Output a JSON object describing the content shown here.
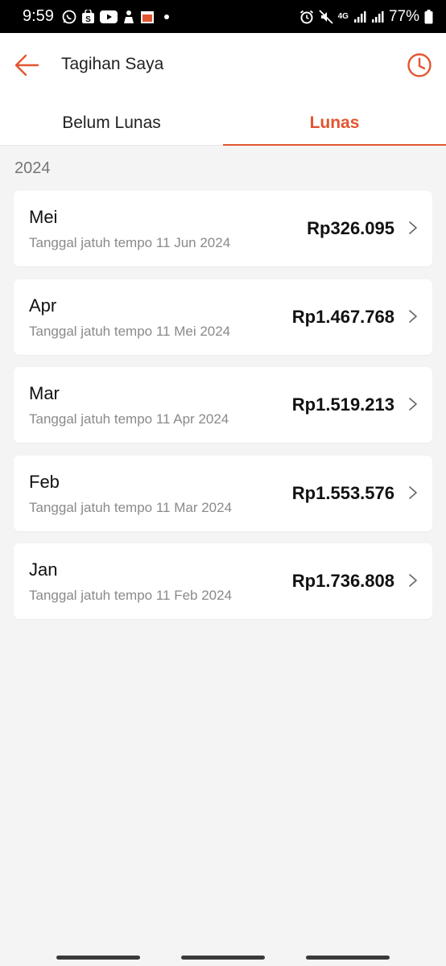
{
  "statusbar": {
    "time": "9:59",
    "battery": "77%",
    "network": "4G",
    "left_icons": [
      "whatsapp-icon",
      "shopee-icon",
      "youtube-icon",
      "app-icon",
      "calendar-icon"
    ],
    "right_icons": [
      "alarm-icon",
      "mute-icon",
      "signal-icon",
      "signal-icon",
      "battery-icon"
    ]
  },
  "header": {
    "title": "Tagihan Saya",
    "back_icon": "arrow-left-icon",
    "history_icon": "clock-icon"
  },
  "tabs": [
    {
      "label": "Belum Lunas",
      "active": false
    },
    {
      "label": "Lunas",
      "active": true
    }
  ],
  "section": {
    "year": "2024"
  },
  "bills": [
    {
      "month": "Mei",
      "due": "Tanggal jatuh tempo 11 Jun 2024",
      "amount": "Rp326.095"
    },
    {
      "month": "Apr",
      "due": "Tanggal jatuh tempo 11 Mei 2024",
      "amount": "Rp1.467.768"
    },
    {
      "month": "Mar",
      "due": "Tanggal jatuh tempo 11 Apr 2024",
      "amount": "Rp1.519.213"
    },
    {
      "month": "Feb",
      "due": "Tanggal jatuh tempo 11 Mar 2024",
      "amount": "Rp1.553.576"
    },
    {
      "month": "Jan",
      "due": "Tanggal jatuh tempo 11 Feb 2024",
      "amount": "Rp1.736.808"
    }
  ],
  "colors": {
    "accent": "#e25530",
    "background": "#f4f4f4",
    "card": "#ffffff",
    "muted_text": "#8a8a8a"
  }
}
